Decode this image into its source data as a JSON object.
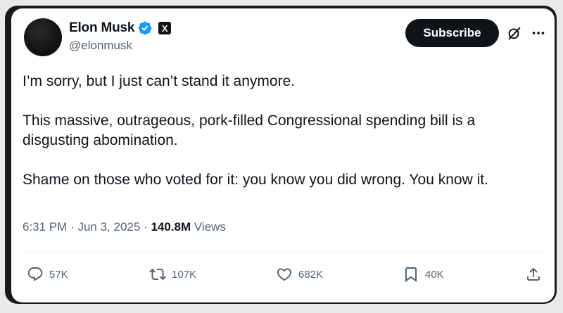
{
  "author": {
    "display_name": "Elon Musk",
    "handle": "@elonmusk",
    "verified_badge": "verified-icon",
    "affiliation_badge": "X",
    "avatar": "avatar"
  },
  "subscribe_label": "Subscribe",
  "tweet": {
    "paragraphs": [
      "I’m sorry, but I just can’t stand it anymore.",
      "This massive, outrageous, pork-filled Congressional spending bill is a disgusting abomination.",
      "Shame on those who voted for it: you know you did wrong. You know it."
    ]
  },
  "meta": {
    "time": "6:31 PM",
    "date": "Jun 3, 2025",
    "separator": "·",
    "views_count": "140.8M",
    "views_label": "Views"
  },
  "actions": {
    "replies": "57K",
    "reposts": "107K",
    "likes": "682K",
    "bookmarks": "40K"
  },
  "colors": {
    "text": "#0f1419",
    "secondary": "#536471",
    "verified": "#1d9bf0",
    "button": "#0f1419"
  }
}
